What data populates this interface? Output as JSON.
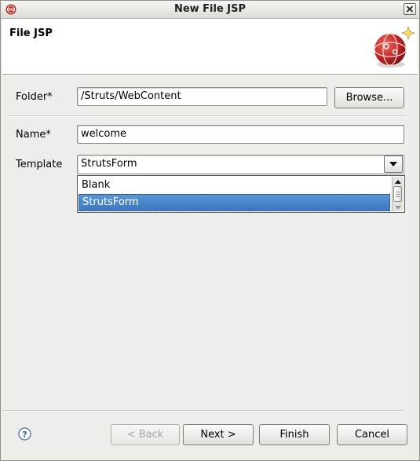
{
  "window": {
    "title": "New File JSP"
  },
  "header": {
    "title": "File JSP"
  },
  "form": {
    "folder_label": "Folder*",
    "folder_value": "/Struts/WebContent",
    "browse_label": "Browse...",
    "name_label": "Name*",
    "name_value": "welcome",
    "template_label": "Template",
    "template_value": "StrutsForm",
    "template_options": [
      "Blank",
      "StrutsForm"
    ],
    "template_selected_index": 1
  },
  "buttons": {
    "back_label": "< Back",
    "next_label": "Next >",
    "finish_label": "Finish",
    "cancel_label": "Cancel"
  },
  "icons": {
    "app": "eclipse-icon",
    "close": "close-icon",
    "wizard": "jsp-globe-icon",
    "help": "help-icon",
    "combo_arrow": "chevron-down-icon"
  },
  "colors": {
    "selection": "#3a77c0",
    "globe_red": "#c0282c"
  }
}
